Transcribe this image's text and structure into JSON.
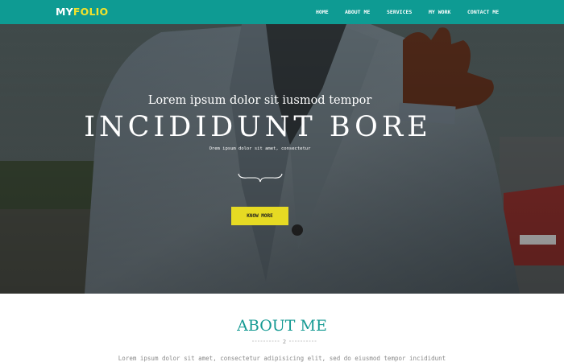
{
  "brand": {
    "logo_part1": "MY",
    "logo_part2": "FOLIO"
  },
  "nav": {
    "items": [
      "HOME",
      "ABOUT ME",
      "SERVICES",
      "MY WORK",
      "CONTACT ME"
    ]
  },
  "hero": {
    "subtitle": "Lorem ipsum dolor sit iusmod tempor",
    "title": "INCIDIDUNT BORE",
    "caption": "Orem ipsum dolor sit amet, consectetur",
    "cta_label": "KNOW MORE"
  },
  "about": {
    "title": "ABOUT ME",
    "text": "Lorem ipsum dolor sit amet, consectetur adipisicing elit, sed do eiusmod tempor incididunt"
  },
  "colors": {
    "nav_bg": "#0e9b93",
    "accent_yellow": "#e6da23",
    "about_title": "#159a93"
  }
}
